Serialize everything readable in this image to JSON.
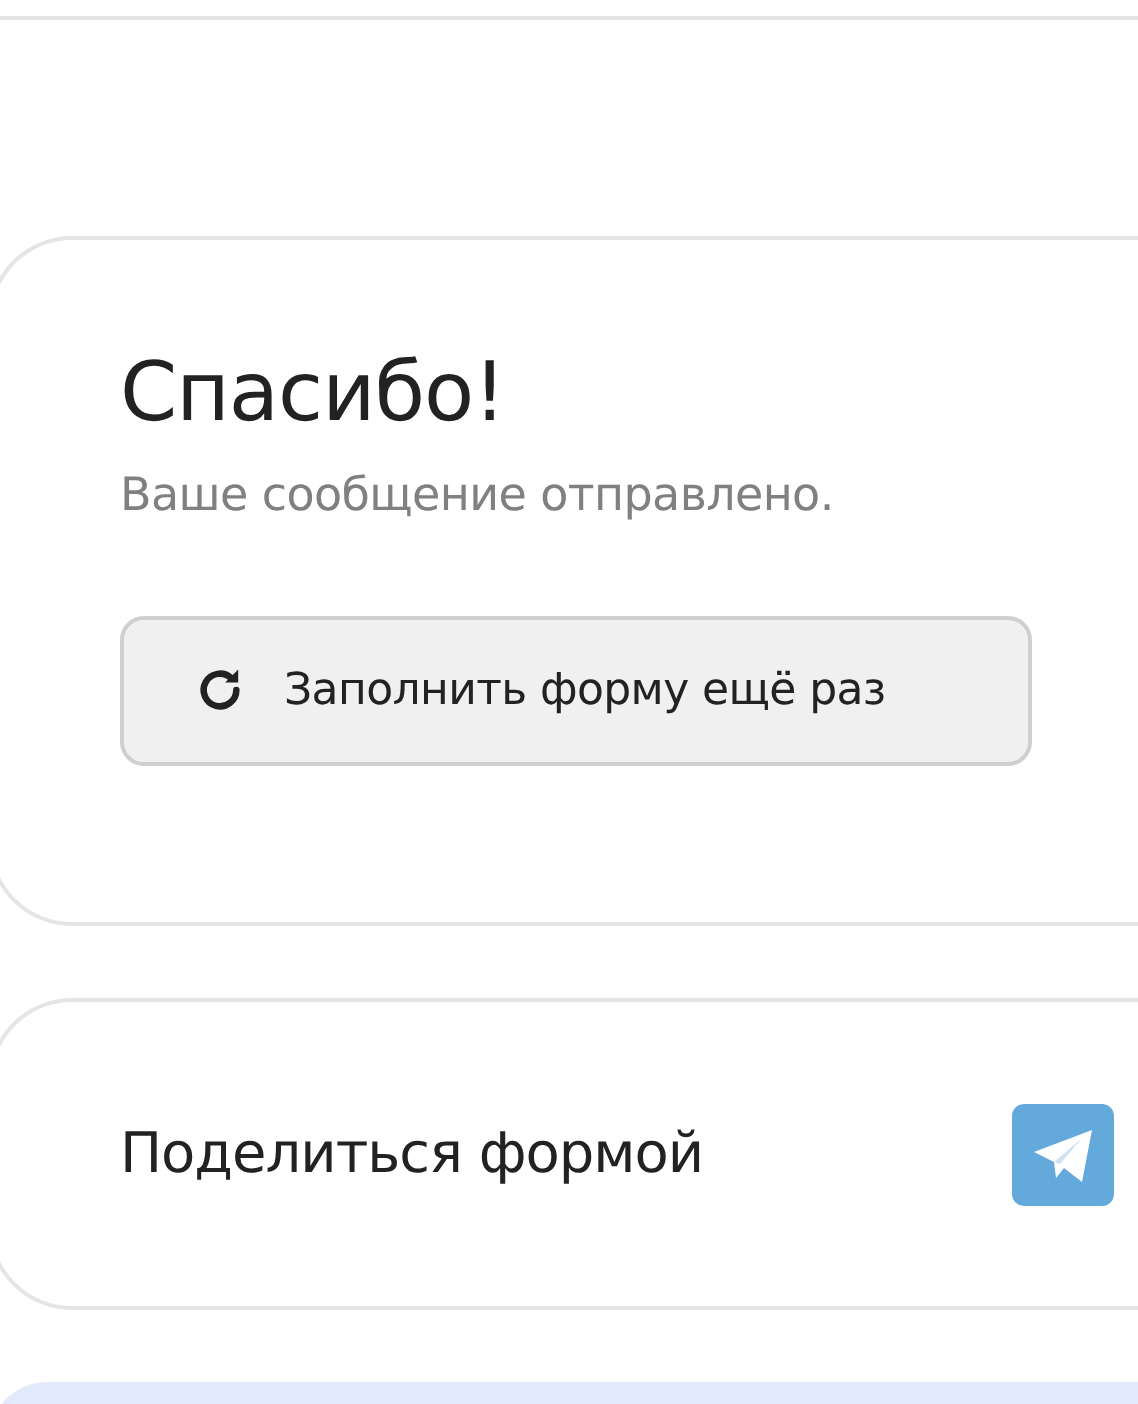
{
  "confirmation": {
    "title": "Спасибо!",
    "message": "Ваше сообщение отправлено.",
    "button": "Заполнить форму ещё раз"
  },
  "share": {
    "title": "Поделиться формой"
  }
}
